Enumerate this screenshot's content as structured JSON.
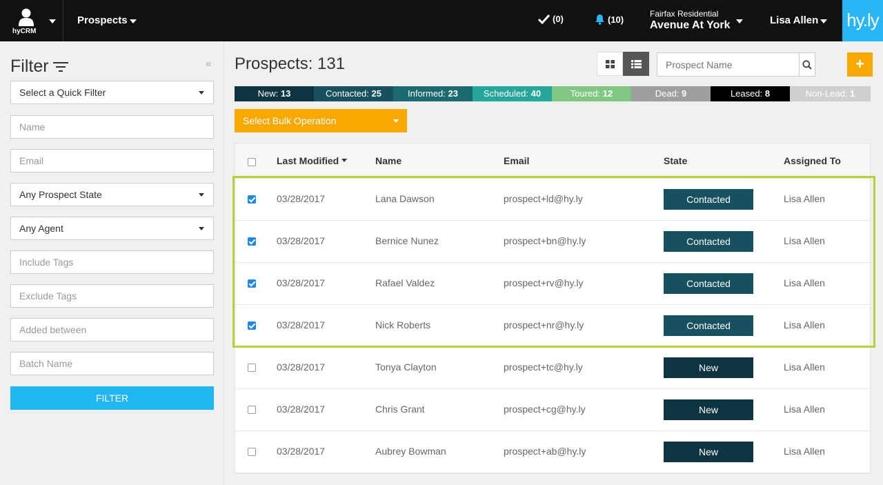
{
  "topbar": {
    "app_name": "hyCRM",
    "nav_label": "Prospects",
    "tasks_count": "(0)",
    "notifications_count": "(10)",
    "property_company": "Fairfax Residential",
    "property_name": "Avenue At York",
    "user_name": "Lisa Allen",
    "brand": "hy.ly"
  },
  "sidebar": {
    "title": "Filter",
    "collapse": "«",
    "quick_filter": "Select a Quick Filter",
    "name_placeholder": "Name",
    "email_placeholder": "Email",
    "state_select": "Any Prospect State",
    "agent_select": "Any Agent",
    "include_tags_placeholder": "Include Tags",
    "exclude_tags_placeholder": "Exclude Tags",
    "added_between_placeholder": "Added between",
    "batch_name_placeholder": "Batch Name",
    "filter_button": "FILTER"
  },
  "main": {
    "title": "Prospects: 131",
    "search_placeholder": "Prospect Name",
    "add_label": "+",
    "bulk_label": "Select Bulk Operation",
    "status_bar": [
      {
        "label": "New:",
        "count": "13",
        "bg": "#0d3440",
        "fg": "#ffffff"
      },
      {
        "label": "Contacted:",
        "count": "25",
        "bg": "#17505e",
        "fg": "#ffffff"
      },
      {
        "label": "Informed:",
        "count": "23",
        "bg": "#1a6a6e",
        "fg": "#ffffff"
      },
      {
        "label": "Scheduled:",
        "count": "40",
        "bg": "#26a69a",
        "fg": "#ffffff"
      },
      {
        "label": "Toured:",
        "count": "12",
        "bg": "#81c784",
        "fg": "#ffffff"
      },
      {
        "label": "Dead:",
        "count": "9",
        "bg": "#9e9e9e",
        "fg": "#ffffff"
      },
      {
        "label": "Leased:",
        "count": "8",
        "bg": "#000000",
        "fg": "#ffffff"
      },
      {
        "label": "Non-Lead:",
        "count": "1",
        "bg": "#cfcfcf",
        "fg": "#ffffff"
      }
    ],
    "table": {
      "headers": {
        "last_modified": "Last Modified",
        "name": "Name",
        "email": "Email",
        "state": "State",
        "assigned_to": "Assigned To"
      },
      "rows": [
        {
          "checked": true,
          "date": "03/28/2017",
          "name": "Lana Dawson",
          "email": "prospect+ld@hy.ly",
          "state": "Contacted",
          "assigned": "Lisa Allen"
        },
        {
          "checked": true,
          "date": "03/28/2017",
          "name": "Bernice Nunez",
          "email": "prospect+bn@hy.ly",
          "state": "Contacted",
          "assigned": "Lisa Allen"
        },
        {
          "checked": true,
          "date": "03/28/2017",
          "name": "Rafael Valdez",
          "email": "prospect+rv@hy.ly",
          "state": "Contacted",
          "assigned": "Lisa Allen"
        },
        {
          "checked": true,
          "date": "03/28/2017",
          "name": "Nick Roberts",
          "email": "prospect+nr@hy.ly",
          "state": "Contacted",
          "assigned": "Lisa Allen"
        },
        {
          "checked": false,
          "date": "03/28/2017",
          "name": "Tonya Clayton",
          "email": "prospect+tc@hy.ly",
          "state": "New",
          "assigned": "Lisa Allen"
        },
        {
          "checked": false,
          "date": "03/28/2017",
          "name": "Chris Grant",
          "email": "prospect+cg@hy.ly",
          "state": "New",
          "assigned": "Lisa Allen"
        },
        {
          "checked": false,
          "date": "03/28/2017",
          "name": "Aubrey Bowman",
          "email": "prospect+ab@hy.ly",
          "state": "New",
          "assigned": "Lisa Allen"
        }
      ]
    }
  },
  "colors": {
    "accent_orange": "#f9a800",
    "accent_blue": "#1fb6f1",
    "highlight_green": "#b5d334"
  }
}
